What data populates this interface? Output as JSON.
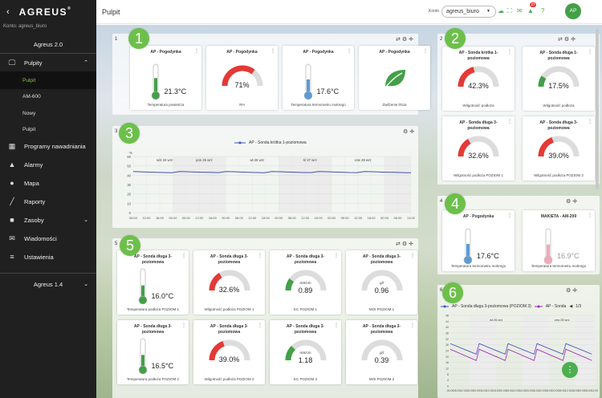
{
  "sidebar": {
    "logo": "AGREUS",
    "account_line": "Konto: agreus_biuro",
    "app_version": "Agreus 2.0",
    "items": [
      {
        "label": "Pulpity",
        "icon": "monitor-icon"
      },
      {
        "label": "Programy nawadniania",
        "icon": "calendar-icon"
      },
      {
        "label": "Alarmy",
        "icon": "bell-icon"
      },
      {
        "label": "Mapa",
        "icon": "globe-icon"
      },
      {
        "label": "Raporty",
        "icon": "chart-line-icon"
      },
      {
        "label": "Zasoby",
        "icon": "truck-icon"
      },
      {
        "label": "Wiadomości",
        "icon": "envelope-icon"
      },
      {
        "label": "Ustawienia",
        "icon": "sliders-icon"
      }
    ],
    "subitems": [
      {
        "label": "Pulpit",
        "active": true
      },
      {
        "label": "AM-600",
        "active": false
      },
      {
        "label": "Nowy",
        "active": false
      },
      {
        "label": "Pulpit",
        "active": false
      }
    ],
    "footer_version": "Agreus 1.4"
  },
  "topbar": {
    "title": "Pulpit",
    "account_label": "Konto",
    "account_value": "agreus_biuro",
    "notifications_count": "27",
    "avatar": "AP"
  },
  "callouts": [
    "1",
    "2",
    "3",
    "4",
    "5",
    "6"
  ],
  "panels": {
    "p1": {
      "num": "1",
      "cards": [
        {
          "title": "AP - Pogodynka",
          "value": "21.3°C",
          "caption": "Temperatura powietrza",
          "kind": "thermo",
          "fill": 0.55,
          "color": "#43a047"
        },
        {
          "title": "AP - Pogodynka",
          "value": "71%",
          "caption": "RH",
          "kind": "gauge",
          "fill": 0.71,
          "color": "#e53935"
        },
        {
          "title": "AP - Pogodynka",
          "value": "17.6°C",
          "caption": "Temperatura termometru mokrego",
          "kind": "thermo",
          "fill": 0.5,
          "color": "#5b9bd5"
        },
        {
          "title": "AP - Pogodynka",
          "value": "",
          "caption": "Zwilżenie liścia",
          "kind": "leaf",
          "color": "#43a047"
        }
      ]
    },
    "p2": {
      "num": "2",
      "cards": [
        {
          "title": "AP - Sonda krótka 1-poziomowa",
          "value": "42.3%",
          "caption": "Wilgotność podłoża",
          "kind": "gauge",
          "fill": 0.42,
          "color": "#e53935"
        },
        {
          "title": "AP - Sonda długa 1-poziomowa",
          "value": "17.5%",
          "caption": "Wilgotność podłoża",
          "kind": "gauge",
          "fill": 0.18,
          "color": "#43a047"
        },
        {
          "title": "AP - Sonda długa 3-poziomowa",
          "value": "32.6%",
          "caption": "Wilgotność podłoża POZIOM 1",
          "kind": "gauge",
          "fill": 0.33,
          "color": "#e53935"
        },
        {
          "title": "AP - Sonda długa 3-poziomowa",
          "value": "39.0%",
          "caption": "Wilgotność podłoża POZIOM 2",
          "kind": "gauge",
          "fill": 0.39,
          "color": "#e53935"
        }
      ]
    },
    "p3": {
      "num": "3"
    },
    "p4": {
      "num": "4",
      "cards": [
        {
          "title": "AP - Pogodynka",
          "value": "17.6°C",
          "caption": "Temperatura termometru mokrego",
          "kind": "thermo",
          "fill": 0.5,
          "color": "#5b9bd5"
        },
        {
          "title": "MAKIETA - AM-209",
          "value": "16.9°C",
          "caption": "Temperatura termometru mokrego",
          "kind": "thermo",
          "fill": 0.48,
          "color": "#f4a7b9",
          "muted": true
        }
      ]
    },
    "p5": {
      "num": "5",
      "cards": [
        {
          "title": "AP - Sonda długa 3-poziomowa",
          "value": "16.0°C",
          "caption": "Temperatura podłoża POZIOM 1",
          "kind": "thermo",
          "fill": 0.45,
          "color": "#43a047"
        },
        {
          "title": "AP - Sonda długa 3-poziomowa",
          "value": "32.6%",
          "caption": "Wilgotność podłoża POZIOM 1",
          "kind": "gauge",
          "fill": 0.33,
          "color": "#e53935"
        },
        {
          "title": "AP - Sonda długa 3-poziomowa",
          "value": "0.89",
          "unit": "mS/cm",
          "caption": "EC POZIOM 1",
          "kind": "gauge",
          "fill": 0.2,
          "color": "#43a047"
        },
        {
          "title": "AP - Sonda długa 3-poziomowa",
          "value": "0.96",
          "unit": "g/l",
          "caption": "MOI POZIOM 1",
          "kind": "gauge",
          "fill": 0.0,
          "color": "#43a047"
        },
        {
          "title": "AP - Sonda długa 3-poziomowa",
          "value": "16.5°C",
          "caption": "Temperatura podłoża POZIOM 2",
          "kind": "thermo",
          "fill": 0.46,
          "color": "#43a047"
        },
        {
          "title": "AP - Sonda długa 3-poziomowa",
          "value": "39.0%",
          "caption": "Wilgotność podłoża POZIOM 2",
          "kind": "gauge",
          "fill": 0.39,
          "color": "#e53935"
        },
        {
          "title": "AP - Sonda długa 3-poziomowa",
          "value": "1.18",
          "unit": "mS/cm",
          "caption": "EC POZIOM 2",
          "kind": "gauge",
          "fill": 0.25,
          "color": "#43a047"
        },
        {
          "title": "AP - Sonda długa 3-poziomowa",
          "value": "0.39",
          "unit": "g/l",
          "caption": "MOI POZIOM 2",
          "kind": "gauge",
          "fill": 0.0,
          "color": "#43a047"
        }
      ]
    },
    "p6": {
      "num": "6"
    }
  },
  "chart_data": [
    {
      "type": "line",
      "series": [
        {
          "name": "AP - Sonda krótka 1-poziomowa",
          "color": "#3f51b5"
        }
      ],
      "day_labels": [
        "ndz 24 wrz",
        "pon 25 wrz",
        "wt 26 wrz",
        "śr 27 wrz",
        "czw 28 wrz"
      ],
      "y_ticks": [
        "60",
        "50",
        "40",
        "30",
        "20",
        "10",
        "0"
      ],
      "ylabel": "%",
      "ylim": [
        0,
        60
      ],
      "x_ticks": [
        "06:00",
        "12:00",
        "18:00",
        "00:00",
        "06:00",
        "12:00",
        "18:00",
        "00:00",
        "06:00",
        "12:00",
        "18:00",
        "00:00",
        "06:00",
        "12:00",
        "18:00",
        "00:00",
        "06:00",
        "12:00",
        "18:00",
        "00:00",
        "06:00",
        "11:00"
      ],
      "values": [
        44.0,
        43.6,
        43.3,
        43.1,
        42.9,
        42.7,
        44.0,
        43.7,
        43.4,
        43.2,
        43.0,
        42.8,
        44.0,
        43.7,
        43.4,
        43.1,
        42.9,
        42.7,
        44.0,
        43.7,
        43.4,
        43.2,
        42.9,
        42.8,
        44.0,
        43.7,
        43.4,
        43.2,
        42.9,
        42.8,
        44.0,
        43.7,
        43.4,
        43.2,
        43.0,
        42.8,
        42.6
      ]
    },
    {
      "type": "line",
      "series": [
        {
          "name": "AP - Sonda długa 3-poziomowa (POZIOM 3)",
          "color": "#3f51b5"
        },
        {
          "name": "AP - Sonda",
          "color": "#9c27b0"
        }
      ],
      "legend_page": "1/3",
      "day_labels": [
        "wt 26 wrz",
        "czw 28 wrz"
      ],
      "y_ticks": [
        "48",
        "44",
        "40",
        "36",
        "32",
        "28",
        "24",
        "20",
        "16",
        "12",
        "8",
        "4",
        "0"
      ],
      "x_ticks": [
        "00:00",
        "06:00",
        "12:00",
        "18:00",
        "00:00",
        "06:00",
        "12:00",
        "18:00",
        "00:00",
        "06:00",
        "12:00",
        "18:00",
        "00:00",
        "06:00",
        "12:00",
        "18:00",
        "00:00",
        "06:00",
        "12:00",
        "18:00",
        "00:00",
        "06:00",
        "11:00"
      ]
    }
  ]
}
